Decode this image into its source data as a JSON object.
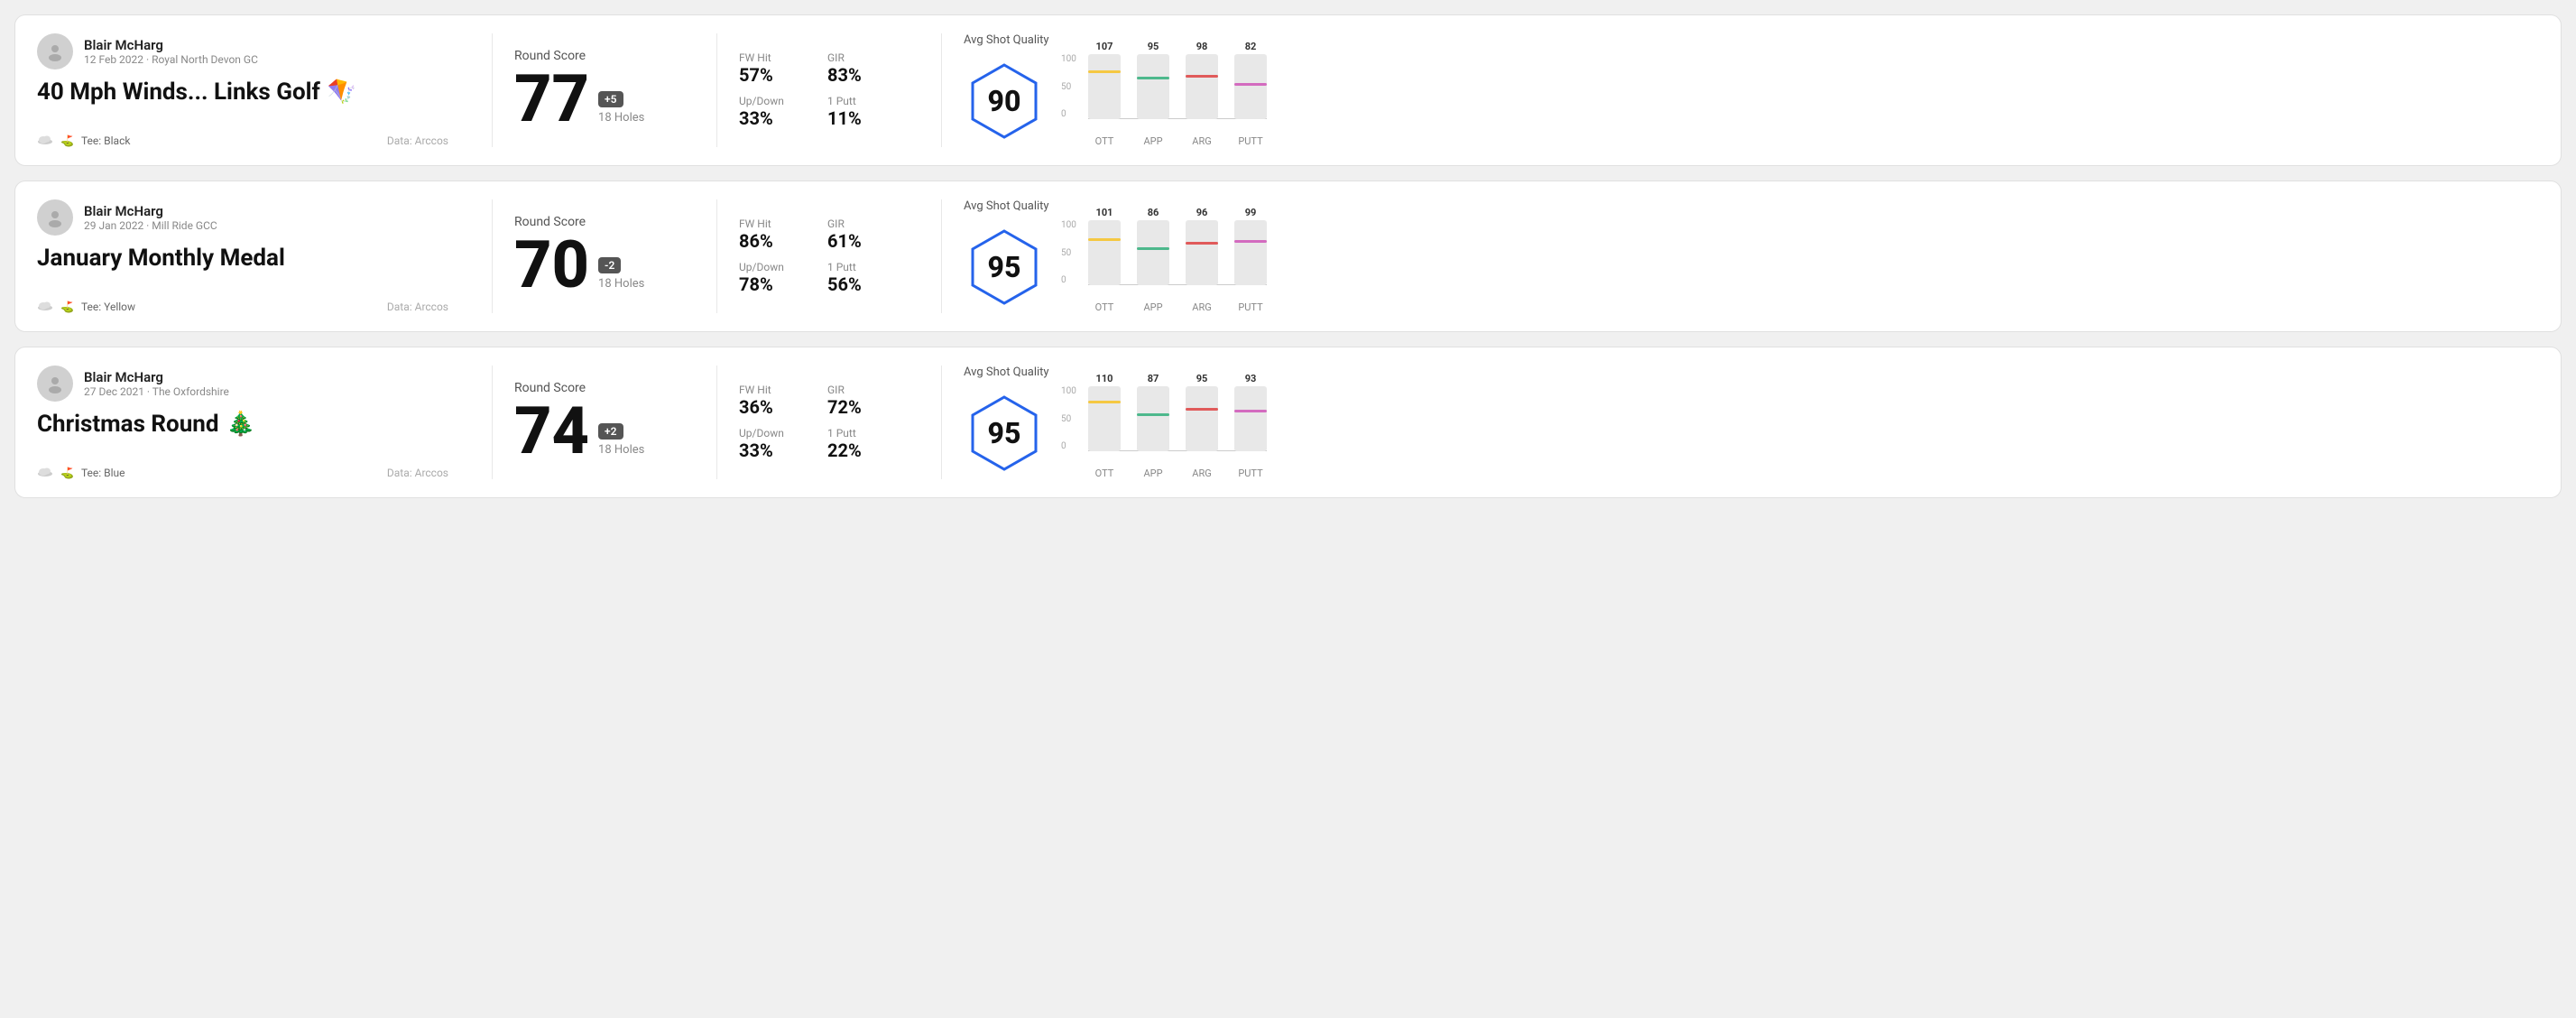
{
  "rounds": [
    {
      "id": "round-1",
      "user": {
        "name": "Blair McHarg",
        "meta": "12 Feb 2022 · Royal North Devon GC"
      },
      "title": "40 Mph Winds... Links Golf",
      "title_emoji": "🪁",
      "tee": "Black",
      "data_source": "Data: Arccos",
      "score": {
        "value": "77",
        "badge": "+5",
        "holes": "18 Holes"
      },
      "stats": {
        "fw_hit_label": "FW Hit",
        "fw_hit_value": "57%",
        "gir_label": "GIR",
        "gir_value": "83%",
        "updown_label": "Up/Down",
        "updown_value": "33%",
        "one_putt_label": "1 Putt",
        "one_putt_value": "11%"
      },
      "quality": {
        "label": "Avg Shot Quality",
        "score": "90",
        "bars": [
          {
            "label": "OTT",
            "value": 107,
            "color": "#f5c842",
            "height": 75
          },
          {
            "label": "APP",
            "value": 95,
            "color": "#4db88c",
            "height": 65
          },
          {
            "label": "ARG",
            "value": 98,
            "color": "#e05a5a",
            "height": 68
          },
          {
            "label": "PUTT",
            "value": 82,
            "color": "#d36bbf",
            "height": 55
          }
        ]
      }
    },
    {
      "id": "round-2",
      "user": {
        "name": "Blair McHarg",
        "meta": "29 Jan 2022 · Mill Ride GCC"
      },
      "title": "January Monthly Medal",
      "title_emoji": "",
      "tee": "Yellow",
      "data_source": "Data: Arccos",
      "score": {
        "value": "70",
        "badge": "-2",
        "holes": "18 Holes"
      },
      "stats": {
        "fw_hit_label": "FW Hit",
        "fw_hit_value": "86%",
        "gir_label": "GIR",
        "gir_value": "61%",
        "updown_label": "Up/Down",
        "updown_value": "78%",
        "one_putt_label": "1 Putt",
        "one_putt_value": "56%"
      },
      "quality": {
        "label": "Avg Shot Quality",
        "score": "95",
        "bars": [
          {
            "label": "OTT",
            "value": 101,
            "color": "#f5c842",
            "height": 72
          },
          {
            "label": "APP",
            "value": 86,
            "color": "#4db88c",
            "height": 58
          },
          {
            "label": "ARG",
            "value": 96,
            "color": "#e05a5a",
            "height": 67
          },
          {
            "label": "PUTT",
            "value": 99,
            "color": "#d36bbf",
            "height": 70
          }
        ]
      }
    },
    {
      "id": "round-3",
      "user": {
        "name": "Blair McHarg",
        "meta": "27 Dec 2021 · The Oxfordshire"
      },
      "title": "Christmas Round",
      "title_emoji": "🎄",
      "tee": "Blue",
      "data_source": "Data: Arccos",
      "score": {
        "value": "74",
        "badge": "+2",
        "holes": "18 Holes"
      },
      "stats": {
        "fw_hit_label": "FW Hit",
        "fw_hit_value": "36%",
        "gir_label": "GIR",
        "gir_value": "72%",
        "updown_label": "Up/Down",
        "updown_value": "33%",
        "one_putt_label": "1 Putt",
        "one_putt_value": "22%"
      },
      "quality": {
        "label": "Avg Shot Quality",
        "score": "95",
        "bars": [
          {
            "label": "OTT",
            "value": 110,
            "color": "#f5c842",
            "height": 78
          },
          {
            "label": "APP",
            "value": 87,
            "color": "#4db88c",
            "height": 59
          },
          {
            "label": "ARG",
            "value": 95,
            "color": "#e05a5a",
            "height": 66
          },
          {
            "label": "PUTT",
            "value": 93,
            "color": "#d36bbf",
            "height": 64
          }
        ]
      }
    }
  ],
  "labels": {
    "round_score": "Round Score",
    "avg_shot_quality": "Avg Shot Quality",
    "tee_prefix": "Tee:",
    "y_axis": [
      "100",
      "50",
      "0"
    ]
  }
}
